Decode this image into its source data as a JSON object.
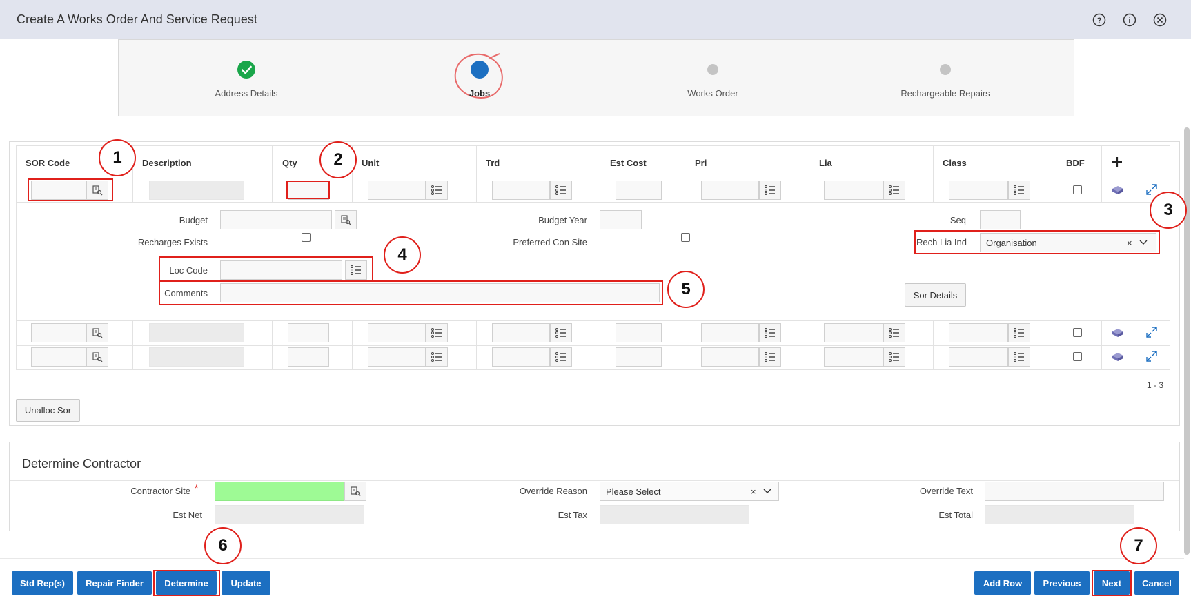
{
  "header": {
    "title": "Create A Works Order And Service Request",
    "icons": [
      "help-icon",
      "info-icon",
      "close-icon"
    ]
  },
  "stepper": {
    "steps": [
      {
        "label": "Address Details",
        "state": "complete"
      },
      {
        "label": "Jobs",
        "state": "current"
      },
      {
        "label": "Works Order",
        "state": "pending"
      },
      {
        "label": "Rechargeable Repairs",
        "state": "pending"
      }
    ]
  },
  "grid": {
    "columns": [
      "SOR Code",
      "Description",
      "Qty",
      "Unit",
      "Trd",
      "Est Cost",
      "Pri",
      "Lia",
      "Class",
      "BDF"
    ],
    "pagination": "1 - 3"
  },
  "detail": {
    "budget_label": "Budget",
    "budget_year_label": "Budget Year",
    "seq_label": "Seq",
    "recharges_exists_label": "Recharges Exists",
    "preferred_con_site_label": "Preferred Con Site",
    "rech_lia_ind_label": "Rech Lia Ind",
    "rech_lia_ind_value": "Organisation",
    "loc_code_label": "Loc Code",
    "comments_label": "Comments",
    "sor_details_button": "Sor Details"
  },
  "unalloc_button": "Unalloc Sor",
  "contractor": {
    "heading": "Determine Contractor",
    "contractor_site_label": "Contractor Site",
    "required_mark": "*",
    "override_reason_label": "Override Reason",
    "override_reason_value": "Please Select",
    "override_text_label": "Override Text",
    "est_net_label": "Est Net",
    "est_tax_label": "Est Tax",
    "est_total_label": "Est Total"
  },
  "footer": {
    "std_reps": "Std Rep(s)",
    "repair_finder": "Repair Finder",
    "determine": "Determine",
    "update": "Update",
    "add_row": "Add Row",
    "previous": "Previous",
    "next": "Next",
    "cancel": "Cancel"
  },
  "annotations": [
    "1",
    "2",
    "3",
    "4",
    "5",
    "6",
    "7"
  ],
  "colors": {
    "primary_button": "#1c6fc1",
    "annotation_red": "#e0201b",
    "complete_green": "#1aa64a",
    "current_blue": "#1c6fc1",
    "required_field_green": "#9efa95"
  }
}
